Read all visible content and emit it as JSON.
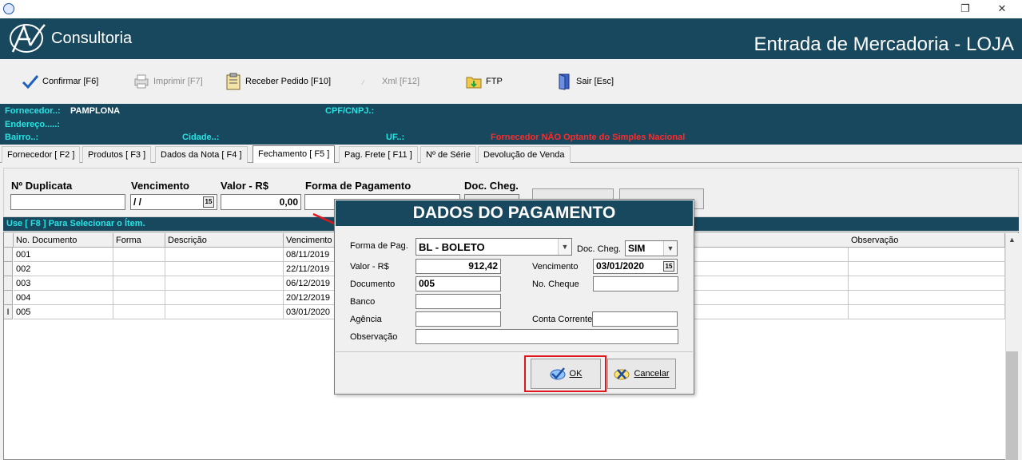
{
  "window": {
    "icon": "chart-app-icon",
    "restore_icon": "restore-icon",
    "close_icon": "close-icon"
  },
  "banner": {
    "logo_text": "Consultoria",
    "form_title": "Entrada de Mercadoria - LOJA"
  },
  "toolbar": {
    "confirm": "Confirmar [F6]",
    "print": "Imprimir  [F7]",
    "receive_order": "Receber Pedido [F10]",
    "xml": "Xml [F12]",
    "ftp": "FTP",
    "exit": "Sair [Esc]"
  },
  "supplier_info": {
    "supplier_label": "Fornecedor..:",
    "supplier_value": "PAMPLONA",
    "cpf_label": "CPF/CNPJ.:",
    "address_label": "Endereço.....:",
    "district_label": "Bairro..:",
    "city_label": "Cidade..:",
    "uf_label": "UF..:",
    "tax_notice": "Fornecedor NÃO Optante do Simples Nacional",
    "notice_color": "#ff2a2a"
  },
  "tabs": [
    {
      "label": "Fornecedor [ F2 ]"
    },
    {
      "label": "Produtos [ F3 ]"
    },
    {
      "label": "Dados da Nota [ F4 ]"
    },
    {
      "label": "Fechamento [ F5 ]"
    },
    {
      "label": "Pag. Frete [ F11 ]"
    },
    {
      "label": "Nº de Série"
    },
    {
      "label": "Devolução de Venda"
    }
  ],
  "fields": {
    "duplicate_label": "Nº Duplicata",
    "due_label": "Vencimento",
    "due_value": " /  /",
    "amount_label": "Valor - R$",
    "amount_value": "0,00",
    "payment_label": "Forma de Pagamento",
    "check_label": "Doc. Cheg."
  },
  "select_hint": "Use [ F8 ] Para Selecionar o Ítem.",
  "grid": {
    "columns": [
      "No. Documento",
      "Forma",
      "Descrição",
      "Vencimento",
      "Observação"
    ],
    "rows": [
      {
        "doc": "001",
        "due": "08/11/2019"
      },
      {
        "doc": "002",
        "due": "22/11/2019"
      },
      {
        "doc": "003",
        "due": "06/12/2019"
      },
      {
        "doc": "004",
        "due": "20/12/2019"
      },
      {
        "doc": "005",
        "due": "03/01/2020"
      }
    ],
    "current_row_marker": "I"
  },
  "dialog": {
    "title": "DADOS DO PAGAMENTO",
    "payment_form_label": "Forma de Pag.",
    "payment_form_value": "BL - BOLETO",
    "doc_check_label": "Doc. Cheg.",
    "doc_check_value": "SIM",
    "amount_label": "Valor - R$",
    "amount_value": "912,42",
    "due_label": "Vencimento",
    "due_value": "03/01/2020",
    "document_label": "Documento",
    "document_value": "005",
    "check_no_label": "No. Cheque",
    "check_no_value": "",
    "bank_label": "Banco",
    "bank_value": "",
    "agency_label": "Agência",
    "agency_value": "",
    "account_label": "Conta Corrente",
    "account_value": "",
    "notes_label": "Observação",
    "notes_value": "",
    "ok_label": "OK",
    "cancel_label": "Cancelar"
  },
  "colors": {
    "banner": "#18485e",
    "label_cyan": "#27e3e3",
    "highlight_red": "#e0161e"
  }
}
